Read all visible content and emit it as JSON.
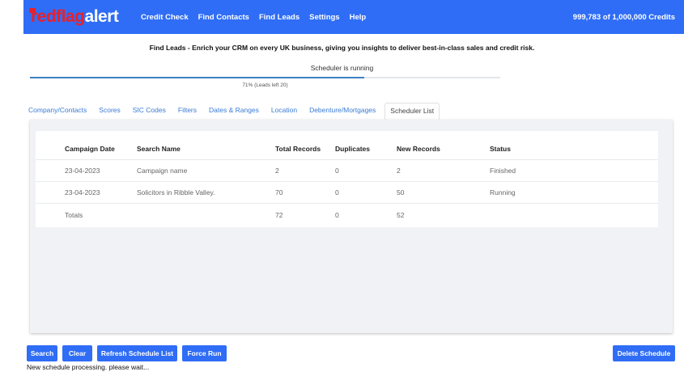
{
  "brand": {
    "logo_part1": "redflag",
    "logo_part2": "alert",
    "accent": "#2f6df6",
    "logo_red": "#e8202a"
  },
  "nav": {
    "links": [
      "Credit Check",
      "Find Contacts",
      "Find Leads",
      "Settings",
      "Help"
    ],
    "credits": "999,783 of 1,000,000 Credits"
  },
  "tagline": "Find Leads - Enrich your CRM on every UK business, giving you insights to deliver best-in-class sales and credit risk.",
  "scheduler": {
    "status": "Scheduler is running",
    "progress_percent": 71,
    "progress_text": "71% (Leads left 20)"
  },
  "tabs": [
    "Company/Contacts",
    "Scores",
    "SIC Codes",
    "Filters",
    "Dates & Ranges",
    "Location",
    "Debenture/Mortgages",
    "Scheduler List"
  ],
  "active_tab": "Scheduler List",
  "table": {
    "headers": [
      "Campaign Date",
      "Search Name",
      "Total Records",
      "Duplicates",
      "New Records",
      "Status"
    ],
    "rows": [
      [
        "23-04-2023",
        "Campaign name",
        "2",
        "0",
        "2",
        "Finished"
      ],
      [
        "23-04-2023",
        "Solicitors in Ribble Valley.",
        "70",
        "0",
        "50",
        "Running"
      ],
      [
        "Totals",
        "",
        "72",
        "0",
        "52",
        ""
      ]
    ]
  },
  "buttons": {
    "search": "Search",
    "clear": "Clear",
    "refresh": "Refresh Schedule List",
    "force_run": "Force Run",
    "delete_schedule": "Delete Schedule"
  },
  "status_message": "New schedule processing. please wait..."
}
